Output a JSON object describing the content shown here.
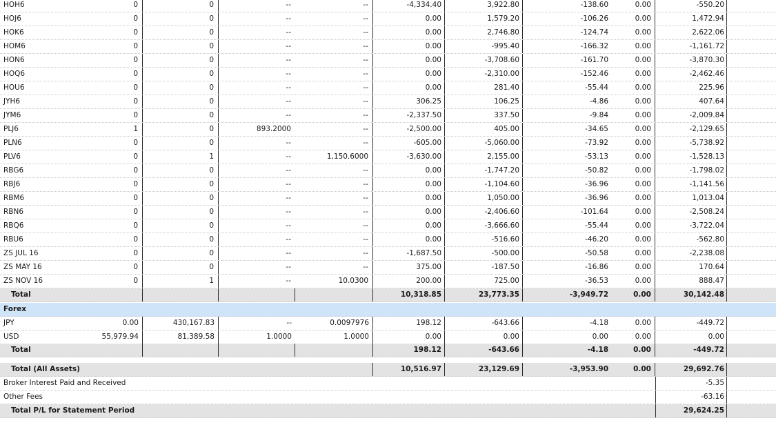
{
  "futures_rows": [
    {
      "symbol": "HOH6",
      "c1": "0",
      "c2": "0",
      "c3": "--",
      "c4": "--",
      "v1": "-4,334.40",
      "v2": "3,922.80",
      "v3": "-138.60",
      "v4": "0.00",
      "v5": "-550.20"
    },
    {
      "symbol": "HOJ6",
      "c1": "0",
      "c2": "0",
      "c3": "--",
      "c4": "--",
      "v1": "0.00",
      "v2": "1,579.20",
      "v3": "-106.26",
      "v4": "0.00",
      "v5": "1,472.94"
    },
    {
      "symbol": "HOK6",
      "c1": "0",
      "c2": "0",
      "c3": "--",
      "c4": "--",
      "v1": "0.00",
      "v2": "2,746.80",
      "v3": "-124.74",
      "v4": "0.00",
      "v5": "2,622.06"
    },
    {
      "symbol": "HOM6",
      "c1": "0",
      "c2": "0",
      "c3": "--",
      "c4": "--",
      "v1": "0.00",
      "v2": "-995.40",
      "v3": "-166.32",
      "v4": "0.00",
      "v5": "-1,161.72"
    },
    {
      "symbol": "HON6",
      "c1": "0",
      "c2": "0",
      "c3": "--",
      "c4": "--",
      "v1": "0.00",
      "v2": "-3,708.60",
      "v3": "-161.70",
      "v4": "0.00",
      "v5": "-3,870.30"
    },
    {
      "symbol": "HOQ6",
      "c1": "0",
      "c2": "0",
      "c3": "--",
      "c4": "--",
      "v1": "0.00",
      "v2": "-2,310.00",
      "v3": "-152.46",
      "v4": "0.00",
      "v5": "-2,462.46"
    },
    {
      "symbol": "HOU6",
      "c1": "0",
      "c2": "0",
      "c3": "--",
      "c4": "--",
      "v1": "0.00",
      "v2": "281.40",
      "v3": "-55.44",
      "v4": "0.00",
      "v5": "225.96"
    },
    {
      "symbol": "JYH6",
      "c1": "0",
      "c2": "0",
      "c3": "--",
      "c4": "--",
      "v1": "306.25",
      "v2": "106.25",
      "v3": "-4.86",
      "v4": "0.00",
      "v5": "407.64"
    },
    {
      "symbol": "JYM6",
      "c1": "0",
      "c2": "0",
      "c3": "--",
      "c4": "--",
      "v1": "-2,337.50",
      "v2": "337.50",
      "v3": "-9.84",
      "v4": "0.00",
      "v5": "-2,009.84"
    },
    {
      "symbol": "PLJ6",
      "c1": "1",
      "c2": "0",
      "c3": "893.2000",
      "c4": "--",
      "v1": "-2,500.00",
      "v2": "405.00",
      "v3": "-34.65",
      "v4": "0.00",
      "v5": "-2,129.65"
    },
    {
      "symbol": "PLN6",
      "c1": "0",
      "c2": "0",
      "c3": "--",
      "c4": "--",
      "v1": "-605.00",
      "v2": "-5,060.00",
      "v3": "-73.92",
      "v4": "0.00",
      "v5": "-5,738.92"
    },
    {
      "symbol": "PLV6",
      "c1": "0",
      "c2": "1",
      "c3": "--",
      "c4": "1,150.6000",
      "v1": "-3,630.00",
      "v2": "2,155.00",
      "v3": "-53.13",
      "v4": "0.00",
      "v5": "-1,528.13"
    },
    {
      "symbol": "RBG6",
      "c1": "0",
      "c2": "0",
      "c3": "--",
      "c4": "--",
      "v1": "0.00",
      "v2": "-1,747.20",
      "v3": "-50.82",
      "v4": "0.00",
      "v5": "-1,798.02"
    },
    {
      "symbol": "RBJ6",
      "c1": "0",
      "c2": "0",
      "c3": "--",
      "c4": "--",
      "v1": "0.00",
      "v2": "-1,104.60",
      "v3": "-36.96",
      "v4": "0.00",
      "v5": "-1,141.56"
    },
    {
      "symbol": "RBM6",
      "c1": "0",
      "c2": "0",
      "c3": "--",
      "c4": "--",
      "v1": "0.00",
      "v2": "1,050.00",
      "v3": "-36.96",
      "v4": "0.00",
      "v5": "1,013.04"
    },
    {
      "symbol": "RBN6",
      "c1": "0",
      "c2": "0",
      "c3": "--",
      "c4": "--",
      "v1": "0.00",
      "v2": "-2,406.60",
      "v3": "-101.64",
      "v4": "0.00",
      "v5": "-2,508.24"
    },
    {
      "symbol": "RBQ6",
      "c1": "0",
      "c2": "0",
      "c3": "--",
      "c4": "--",
      "v1": "0.00",
      "v2": "-3,666.60",
      "v3": "-55.44",
      "v4": "0.00",
      "v5": "-3,722.04"
    },
    {
      "symbol": "RBU6",
      "c1": "0",
      "c2": "0",
      "c3": "--",
      "c4": "--",
      "v1": "0.00",
      "v2": "-516.60",
      "v3": "-46.20",
      "v4": "0.00",
      "v5": "-562.80"
    },
    {
      "symbol": "ZS JUL 16",
      "c1": "0",
      "c2": "0",
      "c3": "--",
      "c4": "--",
      "v1": "-1,687.50",
      "v2": "-500.00",
      "v3": "-50.58",
      "v4": "0.00",
      "v5": "-2,238.08"
    },
    {
      "symbol": "ZS MAY 16",
      "c1": "0",
      "c2": "0",
      "c3": "--",
      "c4": "--",
      "v1": "375.00",
      "v2": "-187.50",
      "v3": "-16.86",
      "v4": "0.00",
      "v5": "170.64"
    },
    {
      "symbol": "ZS NOV 16",
      "c1": "0",
      "c2": "1",
      "c3": "--",
      "c4": "10.0300",
      "v1": "200.00",
      "v2": "725.00",
      "v3": "-36.53",
      "v4": "0.00",
      "v5": "888.47"
    }
  ],
  "futures_total": {
    "label": "Total",
    "v1": "10,318.85",
    "v2": "23,773.35",
    "v3": "-3,949.72",
    "v4": "0.00",
    "v5": "30,142.48"
  },
  "forex_section": {
    "label": "Forex"
  },
  "forex_rows": [
    {
      "symbol": "JPY",
      "c1": "0.00",
      "c2": "430,167.83",
      "c3": "--",
      "c4": "0.0097976",
      "v1": "198.12",
      "v2": "-643.66",
      "v3": "-4.18",
      "v4": "0.00",
      "v5": "-449.72"
    },
    {
      "symbol": "USD",
      "c1": "55,979.94",
      "c2": "81,389.58",
      "c3": "1.0000",
      "c4": "1.0000",
      "v1": "0.00",
      "v2": "0.00",
      "v3": "0.00",
      "v4": "0.00",
      "v5": "0.00"
    }
  ],
  "forex_total": {
    "label": "Total",
    "v1": "198.12",
    "v2": "-643.66",
    "v3": "-4.18",
    "v4": "0.00",
    "v5": "-449.72"
  },
  "grand_total": {
    "label": "Total (All Assets)",
    "v1": "10,516.97",
    "v2": "23,129.69",
    "v3": "-3,953.90",
    "v4": "0.00",
    "v5": "29,692.76"
  },
  "broker_interest": {
    "label": "Broker Interest Paid and Received",
    "value": "-5.35"
  },
  "other_fees": {
    "label": "Other Fees",
    "value": "-63.16"
  },
  "period_total": {
    "label": "Total P/L for Statement Period",
    "value": "29,624.25"
  },
  "colors": {
    "total_row_bg": "#e3e3e3",
    "section_bg": "#cfe4f8",
    "column_rule": "#2a2a2a"
  }
}
